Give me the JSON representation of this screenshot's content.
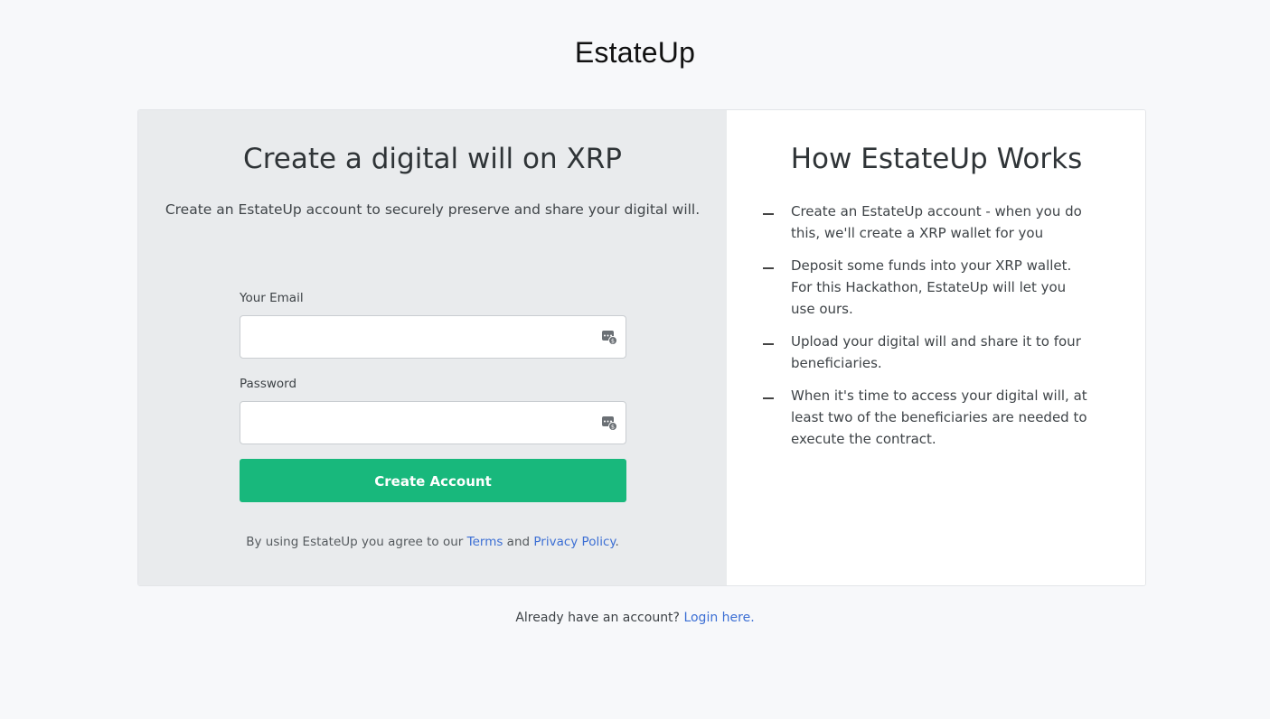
{
  "brand": {
    "name": "EstateUp"
  },
  "signup": {
    "title": "Create a digital will on XRP",
    "subtitle": "Create an EstateUp account to securely preserve and share your digital will.",
    "email_label": "Your Email",
    "email_value": "",
    "password_label": "Password",
    "password_value": "",
    "submit_label": "Create Account",
    "terms_prefix": "By using EstateUp you agree to our ",
    "terms_link": "Terms",
    "terms_and": " and ",
    "privacy_link": "Privacy Policy",
    "terms_suffix": "."
  },
  "how_it_works": {
    "title": "How EstateUp Works",
    "steps": [
      {
        "text": "Create an EstateUp account - when you do this, we'll create a XRP wallet for you"
      },
      {
        "text": "Deposit some funds into your XRP wallet. For this Hackathon, EstateUp will let you use ours."
      },
      {
        "text": "Upload your digital will and share it to four beneficiaries."
      },
      {
        "text": "When it's time to access your digital will, at least two of the beneficiaries are needed to execute the contract."
      }
    ]
  },
  "footer": {
    "prompt": "Already have an account? ",
    "login_link": "Login here."
  },
  "icons": {
    "field_icon": "password-manager-icon"
  },
  "colors": {
    "primary_button": "#18b87c",
    "link": "#3c6fd4",
    "left_panel_bg": "#e9ebed",
    "page_bg": "#f7f8fa"
  }
}
